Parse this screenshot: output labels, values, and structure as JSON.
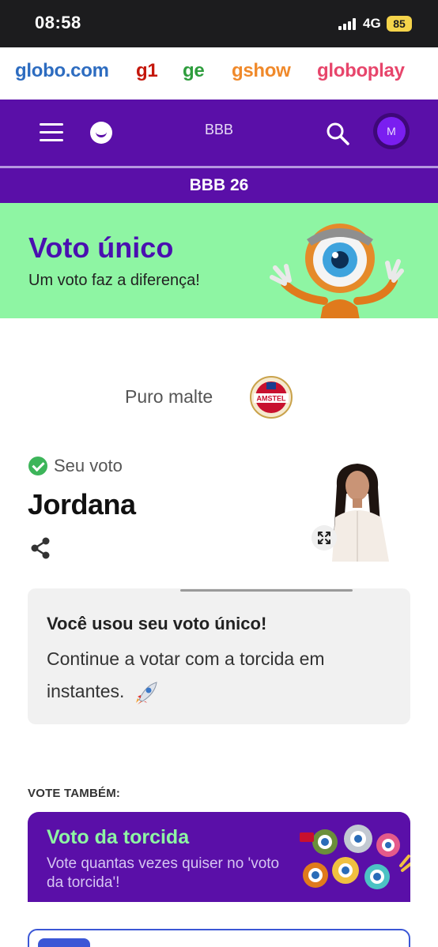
{
  "status_bar": {
    "time": "08:58",
    "network": "4G",
    "battery": "85",
    "icons": [
      "cellular-signal-icon",
      "battery-icon"
    ]
  },
  "brand_bar": {
    "items": [
      {
        "label": "globo.com",
        "color": "#2d6cc0"
      },
      {
        "label": "g1",
        "color": "#c4170c"
      },
      {
        "label": "ge",
        "color": "#2e9d3d"
      },
      {
        "label": "gshow",
        "color": "#f0892a"
      },
      {
        "label": "globoplay",
        "color": "#e7456b"
      }
    ]
  },
  "nav": {
    "title": "BBB",
    "avatar_initial": "M",
    "icons": [
      "menu-icon",
      "smile-logo-icon",
      "search-icon"
    ]
  },
  "section": {
    "title": "BBB 26"
  },
  "hero": {
    "title": "Voto único",
    "subtitle": "Um voto faz a diferença!"
  },
  "sponsor": {
    "label": "Puro malte",
    "logo_text": "AMSTEL"
  },
  "vote": {
    "status": "Seu voto",
    "candidate": "Jordana"
  },
  "info_card": {
    "title": "Você usou seu voto único!",
    "text": "Continue a votar com a torcida em instantes."
  },
  "also_vote": {
    "heading": "VOTE TAMBÉM:",
    "card_title": "Voto da torcida",
    "card_text": "Vote quantas vezes quiser no 'voto da torcida'!"
  },
  "colors": {
    "brand_purple": "#5a0fa8",
    "hero_green": "#8ef5a3",
    "check_green": "#3db55a"
  }
}
